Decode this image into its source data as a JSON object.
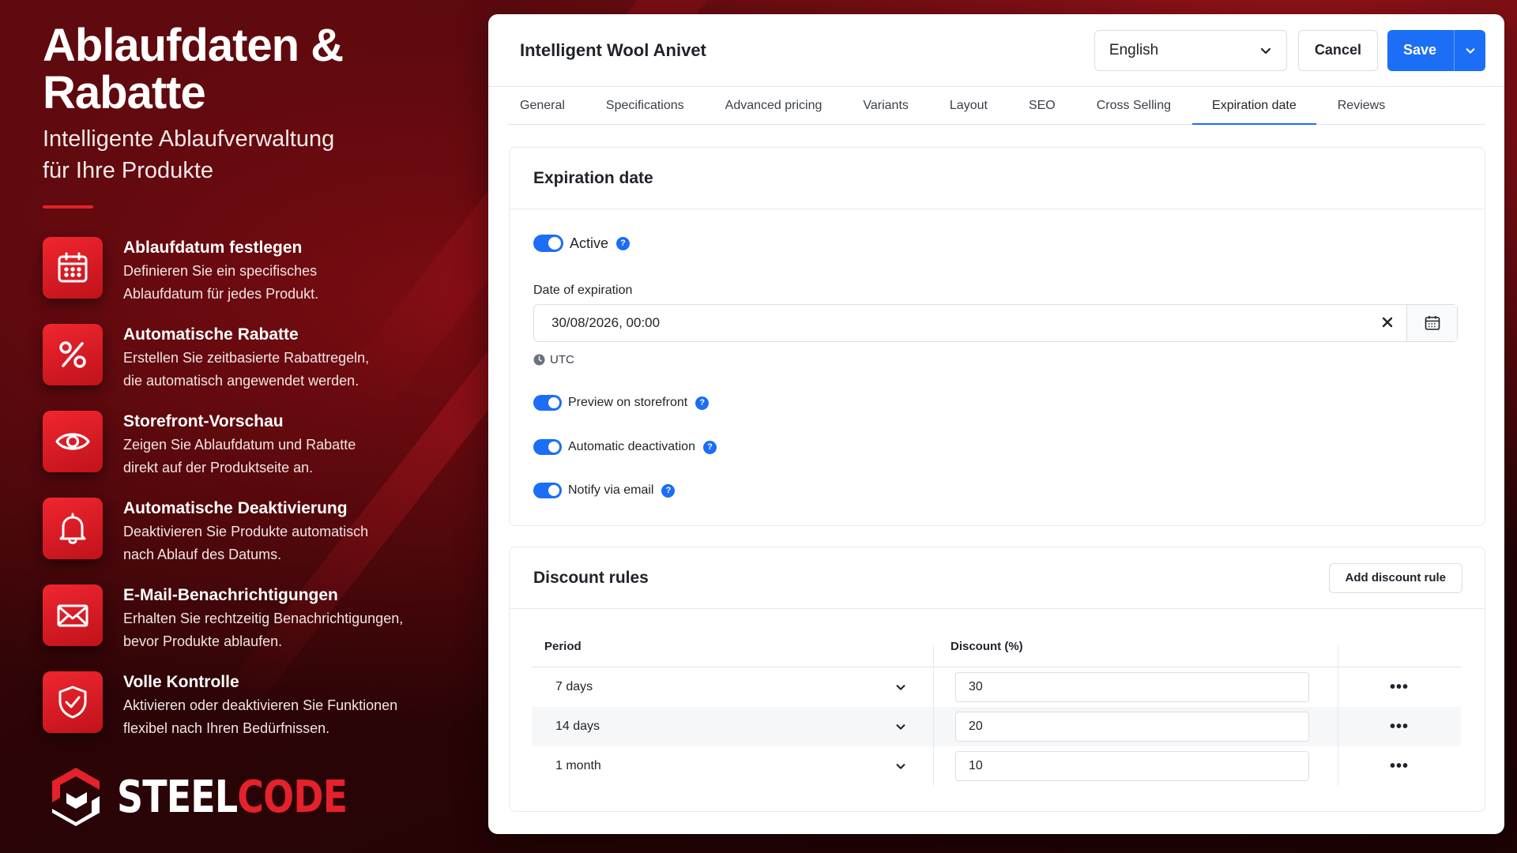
{
  "promo": {
    "headline_line1": "Ablaufdaten &",
    "headline_line2": "Rabatte",
    "subline_line1": "Intelligente Ablaufverwaltung",
    "subline_line2": "für Ihre Produkte",
    "features": [
      {
        "icon": "calendar-icon",
        "title": "Ablaufdatum festlegen",
        "desc1": "Definieren Sie ein specifisches",
        "desc2": "Ablaufdatum für jedes Produkt."
      },
      {
        "icon": "percent-icon",
        "title": "Automatische Rabatte",
        "desc1": "Erstellen Sie zeitbasierte Rabattregeln,",
        "desc2": "die automatisch angewendet werden."
      },
      {
        "icon": "eye-icon",
        "title": "Storefront-Vorschau",
        "desc1": "Zeigen Sie Ablaufdatum und Rabatte",
        "desc2": "direkt auf der Produktseite an."
      },
      {
        "icon": "bell-icon",
        "title": "Automatische Deaktivierung",
        "desc1": "Deaktivieren Sie Produkte automatisch",
        "desc2": "nach Ablauf des Datums."
      },
      {
        "icon": "envelope-icon",
        "title": "E-Mail-Benachrichtigungen",
        "desc1": "Erhalten Sie rechtzeitig Benachrichtigungen,",
        "desc2": "bevor Produkte ablaufen."
      },
      {
        "icon": "shield-check-icon",
        "title": "Volle Kontrolle",
        "desc1": "Aktivieren oder deaktivieren Sie Funktionen",
        "desc2": "flexibel nach Ihren Bedürfnissen."
      }
    ],
    "brand_steel": "STEEL",
    "brand_code": "CODE"
  },
  "colors": {
    "accent_red": "#e3222c",
    "primary_blue": "#1b6ef5"
  },
  "header": {
    "product_title": "Intelligent Wool Anivet",
    "language": "English",
    "cancel_label": "Cancel",
    "save_label": "Save"
  },
  "tabs": [
    {
      "label": "General"
    },
    {
      "label": "Specifications"
    },
    {
      "label": "Advanced pricing"
    },
    {
      "label": "Variants"
    },
    {
      "label": "Layout"
    },
    {
      "label": "SEO"
    },
    {
      "label": "Cross Selling"
    },
    {
      "label": "Expiration date",
      "active": true
    },
    {
      "label": "Reviews"
    }
  ],
  "expiration": {
    "title": "Expiration date",
    "active_label": "Active",
    "date_label": "Date of expiration",
    "date_value": "30/08/2026, 00:00",
    "timezone": "UTC",
    "preview_label": "Preview on storefront",
    "deactivation_label": "Automatic deactivation",
    "notify_label": "Notify via email",
    "help_glyph": "?"
  },
  "discounts": {
    "title": "Discount rules",
    "add_label": "Add discount rule",
    "col_period": "Period",
    "col_discount": "Discount (%)",
    "rows": [
      {
        "period": "7 days",
        "discount": "30"
      },
      {
        "period": "14 days",
        "discount": "20"
      },
      {
        "period": "1 month",
        "discount": "10"
      }
    ],
    "more_glyph": "•••"
  }
}
